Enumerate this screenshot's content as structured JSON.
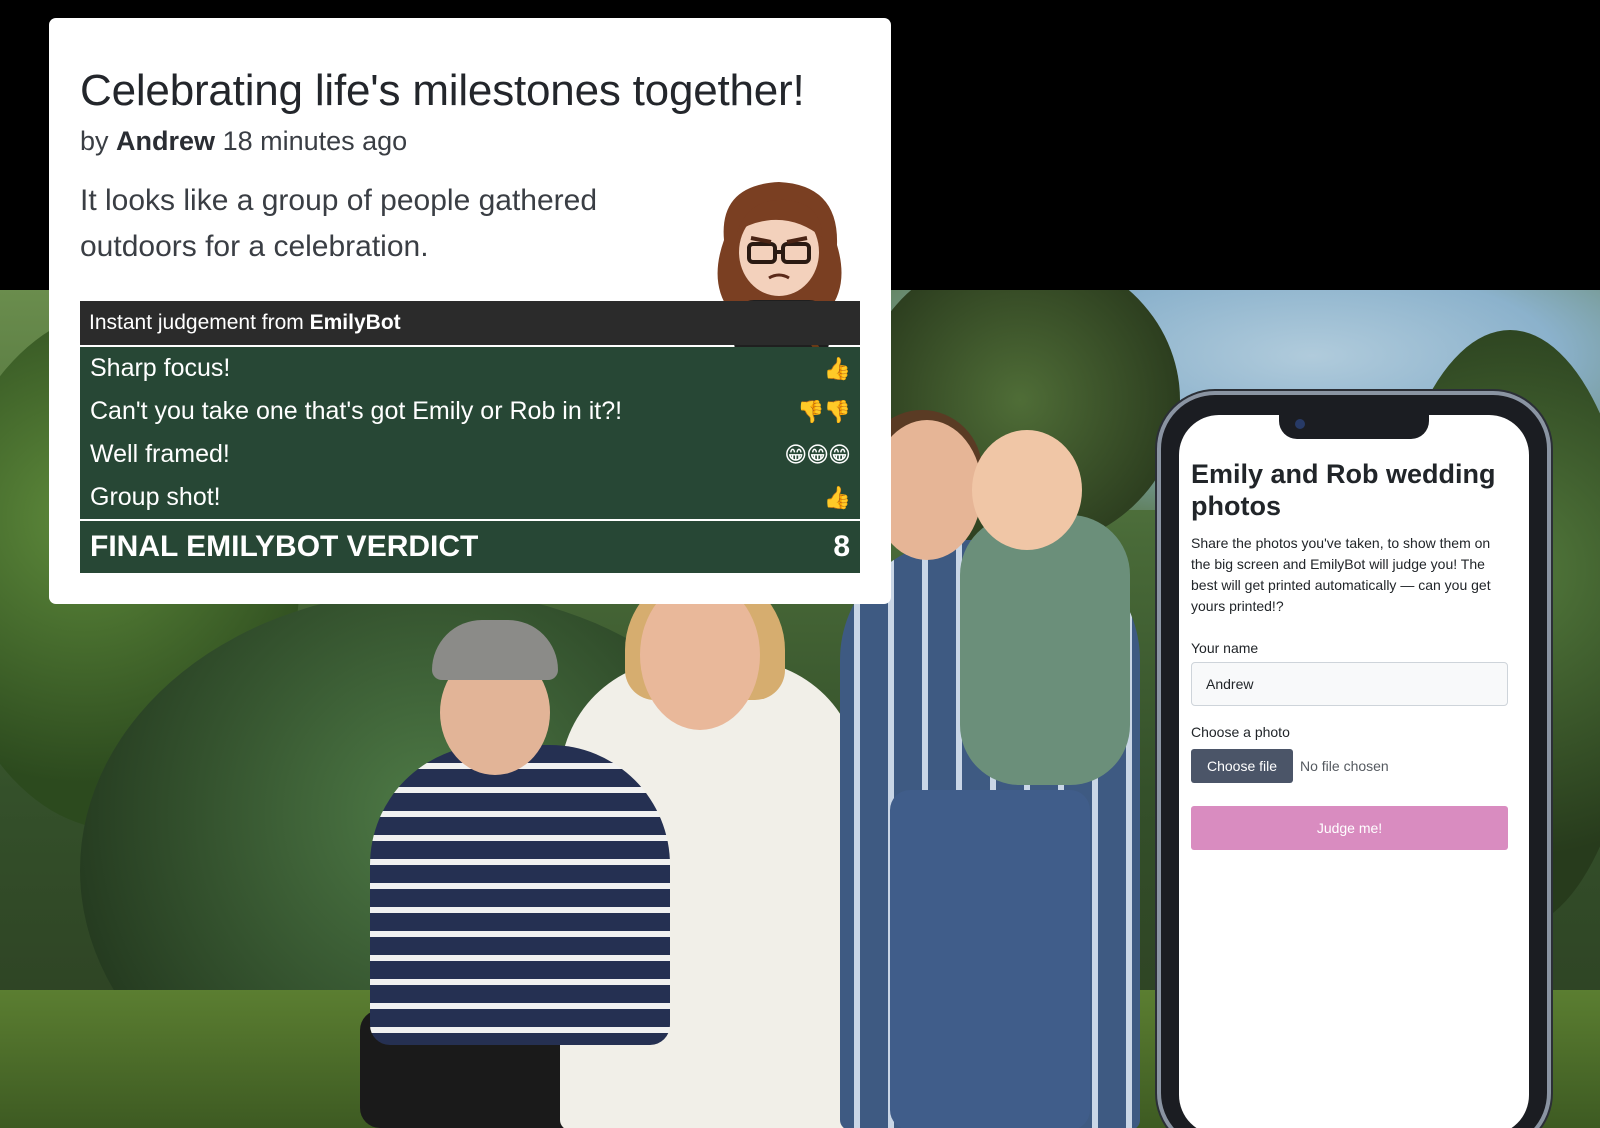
{
  "post": {
    "title": "Celebrating life's milestones together!",
    "by_prefix": "by",
    "author": "Andrew",
    "time_ago": "18 minutes ago",
    "description": "It looks like a group of people gathered outdoors for a celebration."
  },
  "judgement": {
    "header_prefix": "Instant judgement from",
    "bot_name": "EmilyBot",
    "items": [
      {
        "text": "Sharp focus!",
        "reaction": "👍",
        "icon": "thumbs-up"
      },
      {
        "text": "Can't you take one that's got Emily or Rob in it?!",
        "reaction": "👎👎",
        "icon": "thumbs-down"
      },
      {
        "text": "Well framed!",
        "reaction": "😁😁😁",
        "icon": "grin"
      },
      {
        "text": "Group shot!",
        "reaction": "👍",
        "icon": "thumbs-up"
      }
    ],
    "verdict_label": "FINAL EMILYBOT VERDICT",
    "verdict_score": "8",
    "colors": {
      "panel": "#274735",
      "header": "#2b2b2b"
    }
  },
  "phone_app": {
    "title": "Emily and Rob wedding photos",
    "intro": "Share the photos you've taken, to show them on the big screen and EmilyBot will judge you! The best will get printed automatically — can you get yours printed!?",
    "name_label": "Your name",
    "name_value": "Andrew",
    "photo_label": "Choose a photo",
    "file_button": "Choose file",
    "file_status": "No file chosen",
    "submit_label": "Judge me!",
    "colors": {
      "submit": "#d98cc0",
      "file_button": "#4b5568"
    }
  }
}
